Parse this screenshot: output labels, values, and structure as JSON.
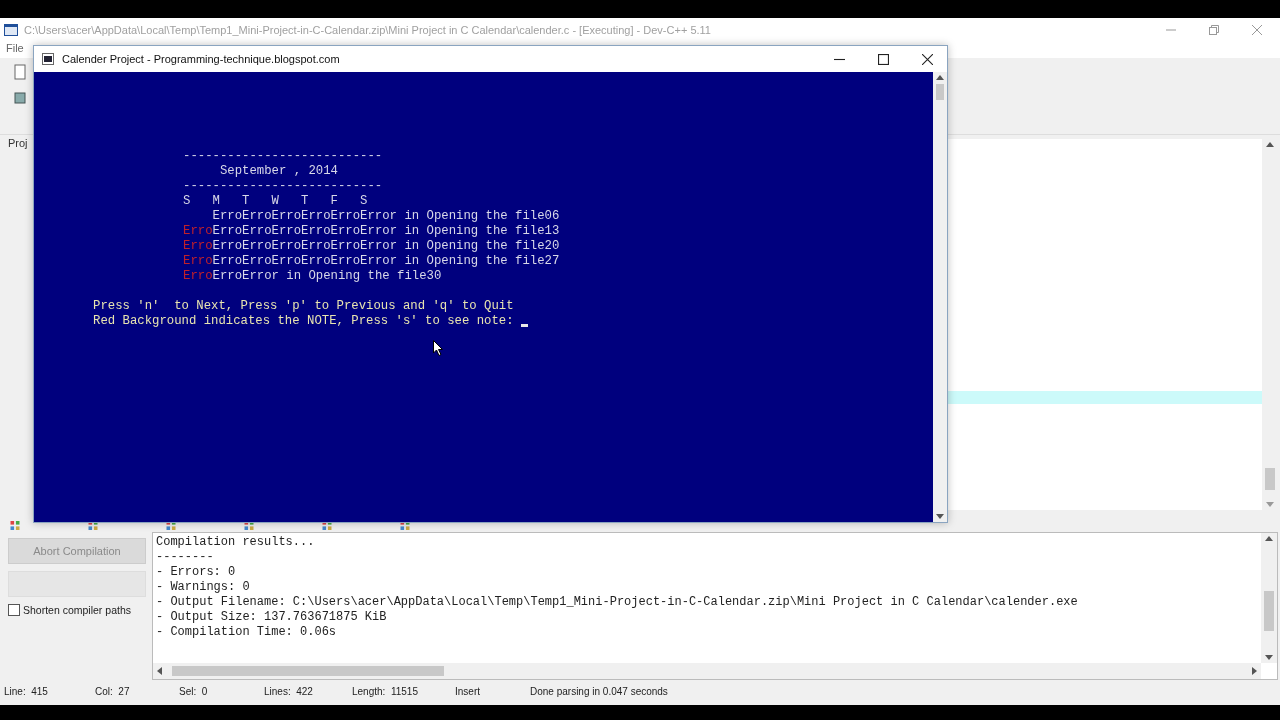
{
  "ide": {
    "title": "C:\\Users\\acer\\AppData\\Local\\Temp\\Temp1_Mini-Project-in-C-Calendar.zip\\Mini Project in C Calendar\\calender.c - [Executing] - Dev-C++ 5.11",
    "menu": [
      "File"
    ],
    "side_tab": "Proj",
    "abort_button": {
      "label": "Abort Compilation",
      "disabled": true
    },
    "shorten_paths": {
      "label": "Shorten compiler paths",
      "checked": false
    },
    "output": [
      "Compilation results...",
      "--------",
      "- Errors: 0",
      "- Warnings: 0",
      "- Output Filename: C:\\Users\\acer\\AppData\\Local\\Temp\\Temp1_Mini-Project-in-C-Calendar.zip\\Mini Project in C Calendar\\calender.exe",
      "- Output Size: 137.763671875 KiB",
      "- Compilation Time: 0.06s"
    ],
    "status": [
      {
        "label": "Line:",
        "value": "415"
      },
      {
        "label": "Col:",
        "value": "27"
      },
      {
        "label": "Sel:",
        "value": "0"
      },
      {
        "label": "Lines:",
        "value": "422"
      },
      {
        "label": "Length:",
        "value": "11515"
      },
      {
        "value": "Insert"
      },
      {
        "value": "Done parsing in 0.047 seconds"
      }
    ]
  },
  "console": {
    "title": "Calender Project - Programming-technique.blogspot.com",
    "calendar_lines": [
      {
        "segments": [
          {
            "kind": "plain",
            "text": "---------------------------"
          }
        ]
      },
      {
        "segments": [
          {
            "kind": "plain",
            "text": "     September , 2014"
          }
        ]
      },
      {
        "segments": [
          {
            "kind": "plain",
            "text": "---------------------------"
          }
        ]
      },
      {
        "segments": [
          {
            "kind": "plain",
            "text": "S   M   T   W   T   F   S"
          }
        ]
      },
      {
        "segments": [
          {
            "kind": "plain",
            "text": "    ErroErroErroErroErroError in Opening the file06"
          }
        ]
      },
      {
        "segments": [
          {
            "kind": "note",
            "text": "Erro"
          },
          {
            "kind": "plain",
            "text": "ErroErroErroErroErroError in Opening the file13"
          }
        ]
      },
      {
        "segments": [
          {
            "kind": "note",
            "text": "Erro"
          },
          {
            "kind": "plain",
            "text": "ErroErroErroErroErroError in Opening the file20"
          }
        ]
      },
      {
        "segments": [
          {
            "kind": "note",
            "text": "Erro"
          },
          {
            "kind": "plain",
            "text": "ErroErroErroErroErroError in Opening the file27"
          }
        ]
      },
      {
        "segments": [
          {
            "kind": "note",
            "text": "Erro"
          },
          {
            "kind": "plain",
            "text": "ErroError in Opening the file30"
          }
        ]
      }
    ],
    "prompts": [
      "Press 'n'  to Next, Press 'p' to Previous and 'q' to Quit",
      "Red Background indicates the NOTE, Press 's' to see note: "
    ]
  }
}
